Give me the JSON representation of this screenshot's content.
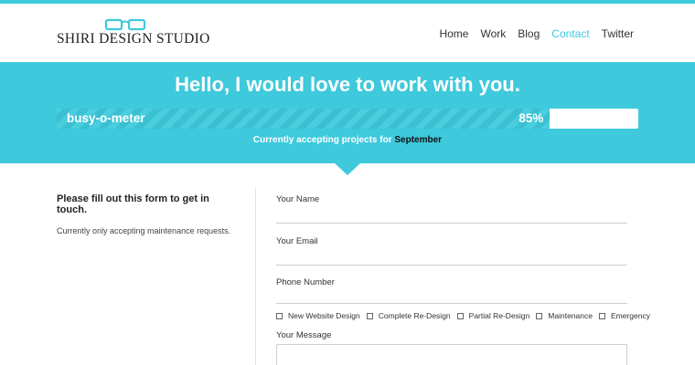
{
  "brand": {
    "name": "SHIRI DESIGN STUDIO",
    "logo_icon": "glasses-icon",
    "accent": "#3ec9dc"
  },
  "nav": {
    "items": [
      {
        "label": "Home",
        "active": false
      },
      {
        "label": "Work",
        "active": false
      },
      {
        "label": "Blog",
        "active": false
      },
      {
        "label": "Contact",
        "active": true
      },
      {
        "label": "Twitter",
        "active": false
      }
    ]
  },
  "banner": {
    "title": "Hello, I would love to work with you.",
    "meter_label": "busy-o-meter",
    "meter_percent_text": "85%",
    "meter_value": 0.85,
    "subtitle_prefix": "Currently accepting projects for",
    "month": "September"
  },
  "intro": {
    "title": "Please fill out this form to get in touch.",
    "note": "Currently only accepting maintenance requests."
  },
  "form": {
    "name_label": "Your Name",
    "email_label": "Your Email",
    "phone_label": "Phone Number",
    "options": [
      "New Website Design",
      "Complete Re-Design",
      "Partial Re-Design",
      "Maintenance",
      "Emergency"
    ],
    "message_label": "Your Message"
  }
}
